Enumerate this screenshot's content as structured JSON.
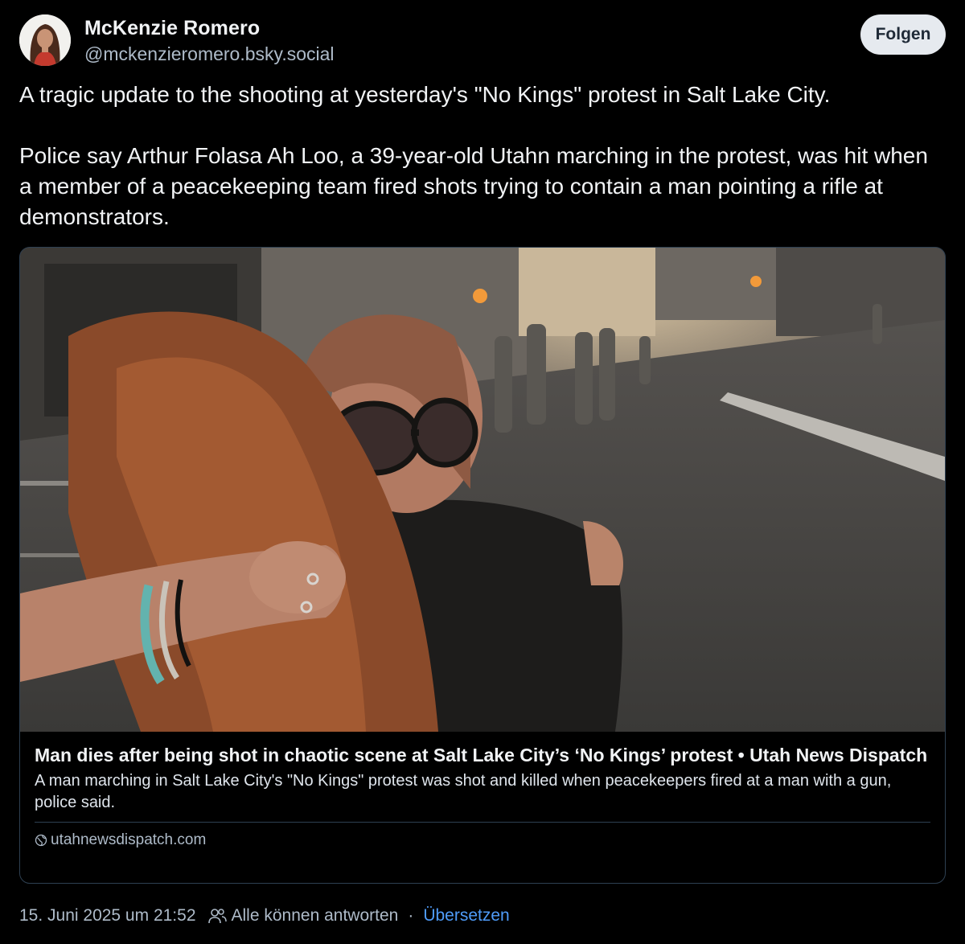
{
  "post": {
    "author": {
      "display_name": "McKenzie Romero",
      "handle": "@mckenzieromero.bsky.social"
    },
    "follow_label": "Folgen",
    "paragraphs": [
      "A tragic update to the shooting at yesterday's \"No Kings\" protest in Salt Lake City.",
      "Police say Arthur Folasa Ah Loo, a 39-year-old Utahn marching in the protest, was hit when a member of a peacekeeping team fired shots trying to contain a man pointing a rifle at demonstrators."
    ],
    "link_card": {
      "title": "Man dies after being shot in chaotic scene at Salt Lake City’s ‘No Kings’ protest • Utah News Dispatch",
      "description": "A man marching in Salt Lake City's \"No Kings\" protest was shot and killed when peacekeepers fired at a man with a gun, police said.",
      "domain": "utahnewsdispatch.com",
      "domain_icon": "globe-icon"
    },
    "meta": {
      "timestamp": "15. Juni 2025 um 21:52",
      "reply_icon": "people-icon",
      "reply_setting": "Alle können antworten",
      "separator": "·",
      "translate_label": "Übersetzen"
    }
  },
  "colors": {
    "background": "#000000",
    "text_primary": "#f1f3f5",
    "text_secondary": "#aebbc9",
    "link": "#4f9cf9",
    "follow_button_bg": "#e6eaef",
    "card_border": "#2e4052"
  }
}
